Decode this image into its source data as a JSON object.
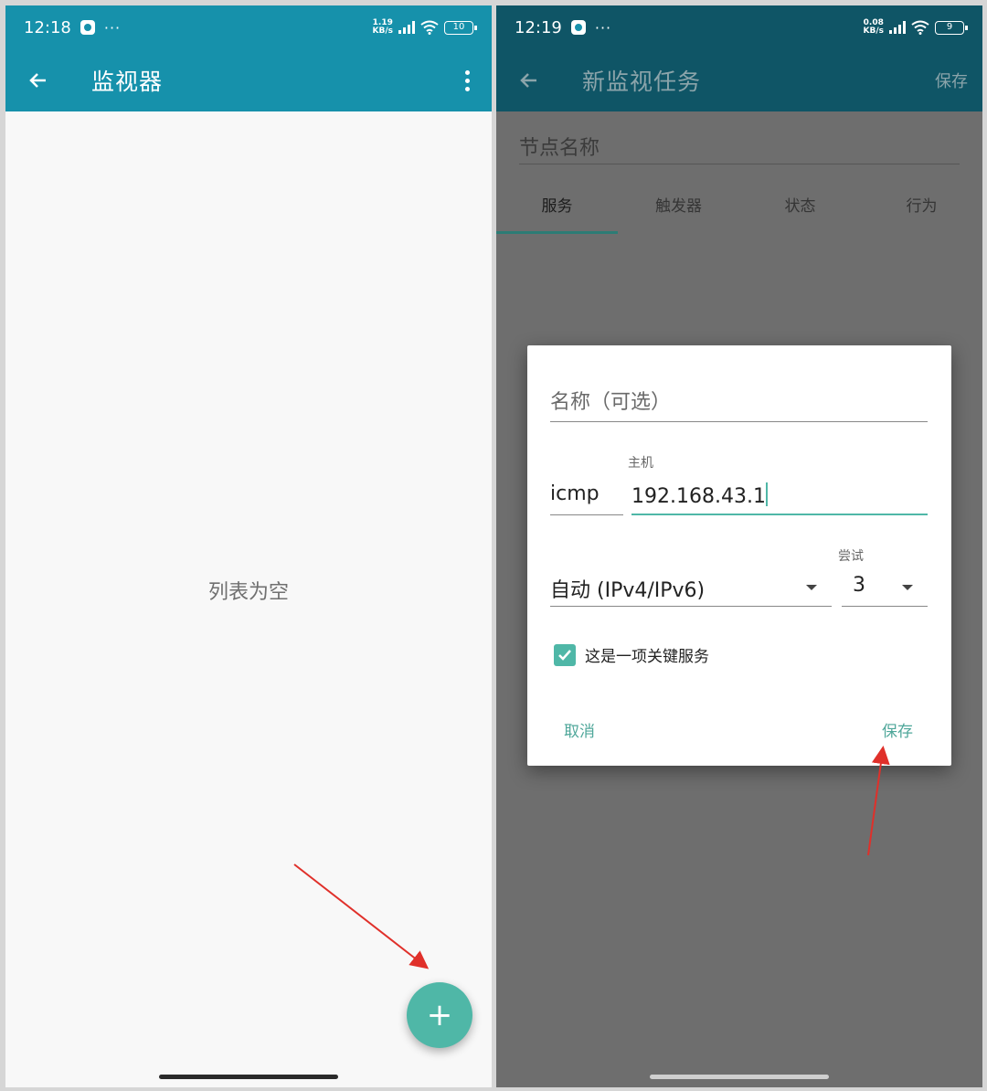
{
  "left_screen": {
    "status": {
      "time": "12:18",
      "more": "···",
      "speed_top": "1.19",
      "speed_bottom": "KB/s",
      "battery": "10"
    },
    "appbar": {
      "title": "监视器"
    },
    "empty_text": "列表为空",
    "fab_icon": "add-icon"
  },
  "right_screen": {
    "status": {
      "time": "12:19",
      "more": "···",
      "speed_top": "0.08",
      "speed_bottom": "KB/s",
      "battery": "9"
    },
    "appbar": {
      "title": "新监视任务",
      "save": "保存"
    },
    "node_name_placeholder": "节点名称",
    "tabs": [
      "服务",
      "触发器",
      "状态",
      "行为"
    ],
    "dialog": {
      "name_placeholder": "名称（可选）",
      "protocol": "icmp",
      "host_label": "主机",
      "host_value": "192.168.43.1",
      "ip_version": "自动 (IPv4/IPv6)",
      "retry_label": "尝试",
      "retry_value": "3",
      "critical_label": "这是一项关键服务",
      "critical_checked": true,
      "cancel": "取消",
      "save": "保存"
    }
  },
  "colors": {
    "appbar": "#1691ab",
    "appbar_dimmed": "#0f5566",
    "accent": "#4fb7a7",
    "annotation_arrow": "#e0302a"
  }
}
